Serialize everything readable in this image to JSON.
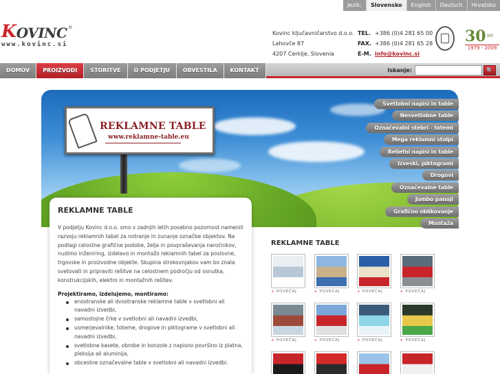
{
  "lang": {
    "label": "Jezik:",
    "options": [
      "Slovensko",
      "English",
      "Deutsch",
      "Hrvatsko"
    ],
    "active": "Slovensko"
  },
  "logo": {
    "initial": "K",
    "rest": "OVINC",
    "registered": "®",
    "url": "www.kovinc.si"
  },
  "company": {
    "name": "Kovinc ključavničarstvo d.o.o.",
    "street": "Lahovče 87",
    "city": "4207 Cerklje, Slovenia"
  },
  "contact": {
    "tel_label": "TEL.",
    "tel": "+386 (0)4 281 65 00",
    "fax_label": "FAX.",
    "fax": "+386 (0)4 281 65 28",
    "mail_label": "E-M.",
    "mail": "info@kovinc.si"
  },
  "anniversary": {
    "number": "30",
    "word": "let",
    "years": "1979 - 2009"
  },
  "nav": {
    "items": [
      "DOMOV",
      "PROIZVODI",
      "STORITVE",
      "O PODJETJU",
      "OBVESTILA",
      "KONTAKT"
    ],
    "active_index": 1,
    "search_label": "Iskanje:",
    "search_value": "",
    "search_button": "🔍"
  },
  "hero": {
    "billboard_title": "REKLAMNE TABLE",
    "billboard_url": "www.reklamne-table.eu"
  },
  "sidemenu": {
    "items": [
      "Svetlobni napisi in table",
      "Nesvetlobne table",
      "Označevalni stebri - totemi",
      "Mega reklamni stolpi",
      "Reliefni napisi in table",
      "Izveski, piktogrami",
      "Drogovi",
      "Označevalne table",
      "Jumbo panoji",
      "Grafično oblikovanje",
      "Montaža"
    ]
  },
  "content": {
    "title": "REKLAMNE TABLE",
    "paragraph": "V podjetju Kovinc d.o.o. smo v zadnjih letih posebno pozornost namenili razvoju reklamnih tabel za notranje in zunanje označbe objektov. Na podlagi celostne grafične podobe, želja in povpraševanja naročnikov, nudimo inženiring, izdelavo in montažo reklamnih tabel za poslovne, trgovske in proizvodne objekte. Skupina strokovnjakov vam bo znala svetovati in pripraviti rešitve na celostnem področju od osnutka, konstrukcijskih, elektro in montažnih rešitev.",
    "subheading": "Projektiramo, izdelujemo, montiramo:",
    "list": [
      "enostranske ali dvostranske reklamne table v svetlobni ali navadni izvedbi,",
      "samostojne črke v svetlobni ali navadni izvedbi,",
      "usmerjevalnike, toteme, drogove in piktograme v svetlobni ali navadni izvedbi,",
      "svetlobne kasete, obrobe in konzole z napisno površino iz platna, pleksija ali aluminija,",
      "obcestne označevalne table v svetlobni ali navadni izvedbi."
    ]
  },
  "gallery": {
    "title": "REKLAMNE TABLE",
    "caption": "+ POVEČAJ",
    "thumbs": [
      {
        "colors": [
          "#e8eef2",
          "#b7c7d6",
          "#ffffff"
        ]
      },
      {
        "colors": [
          "#8fb6e0",
          "#c9b28a",
          "#3b6fb0"
        ]
      },
      {
        "colors": [
          "#2a5fa8",
          "#e9e2c8",
          "#c8252b"
        ]
      },
      {
        "colors": [
          "#5a6b7a",
          "#c8252b",
          "#8a8f94"
        ]
      },
      {
        "colors": [
          "#7a8a94",
          "#9c4b3a",
          "#c8d6e0"
        ]
      },
      {
        "colors": [
          "#7aa6d8",
          "#c8252b",
          "#e0e0e0"
        ]
      },
      {
        "colors": [
          "#3b5a7a",
          "#8fd6e8",
          "#e8f4f8"
        ]
      },
      {
        "colors": [
          "#2a3a2a",
          "#e8c84a",
          "#4aa84a"
        ]
      },
      {
        "colors": [
          "#c8252b",
          "#1a1a1a",
          "#e8e8e8"
        ]
      },
      {
        "colors": [
          "#d42a2a",
          "#2a2a2a",
          "#ffffff"
        ]
      },
      {
        "colors": [
          "#9cc4e8",
          "#c8252b",
          "#e8e8e8"
        ]
      },
      {
        "colors": [
          "#c8252b",
          "#f0f0f0",
          "#3b6fb0"
        ]
      }
    ]
  }
}
